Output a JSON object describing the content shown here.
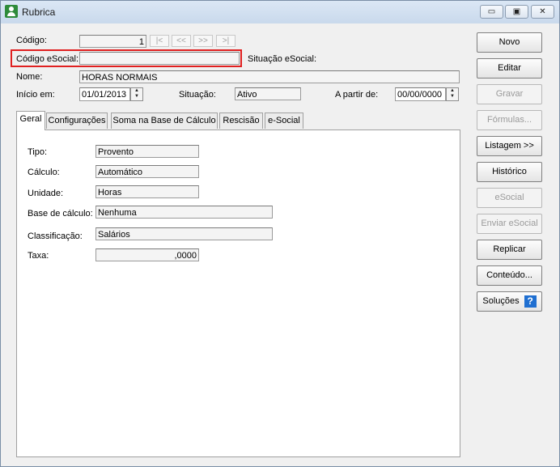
{
  "window": {
    "title": "Rubrica",
    "controls": {
      "minimize": "▭",
      "maximize": "▣",
      "close": "✕"
    }
  },
  "header": {
    "codigo_label": "Código:",
    "codigo_value": "1",
    "nav": {
      "first": "|<",
      "prev": "<<",
      "next": ">>",
      "last": ">|"
    },
    "codigo_esocial_label": "Código eSocial:",
    "codigo_esocial_value": "",
    "situacao_esocial_label": "Situação eSocial:",
    "situacao_esocial_value": "",
    "nome_label": "Nome:",
    "nome_value": "HORAS NORMAIS",
    "inicio_label": "Início em:",
    "inicio_value": "01/01/2013",
    "situacao_label": "Situação:",
    "situacao_value": "Ativo",
    "a_partir_label": "A partir de:",
    "a_partir_value": "00/00/0000"
  },
  "tabs": [
    "Geral",
    "Configurações",
    "Soma na Base de Cálculo",
    "Rescisão",
    "e-Social"
  ],
  "geral": {
    "tipo_label": "Tipo:",
    "tipo_value": "Provento",
    "calculo_label": "Cálculo:",
    "calculo_value": "Automático",
    "unidade_label": "Unidade:",
    "unidade_value": "Horas",
    "base_label": "Base de cálculo:",
    "base_value": "Nenhuma",
    "classificacao_label": "Classificação:",
    "classificacao_value": "Salários",
    "taxa_label": "Taxa:",
    "taxa_value": ",0000"
  },
  "buttons": {
    "novo": "Novo",
    "editar": "Editar",
    "gravar": "Gravar",
    "formulas": "Fórmulas...",
    "listagem": "Listagem >>",
    "historico": "Histórico",
    "esocial": "eSocial",
    "enviar_esocial": "Enviar eSocial",
    "replicar": "Replicar",
    "conteudo": "Conteúdo...",
    "solucoes": "Soluções",
    "help_glyph": "?"
  }
}
